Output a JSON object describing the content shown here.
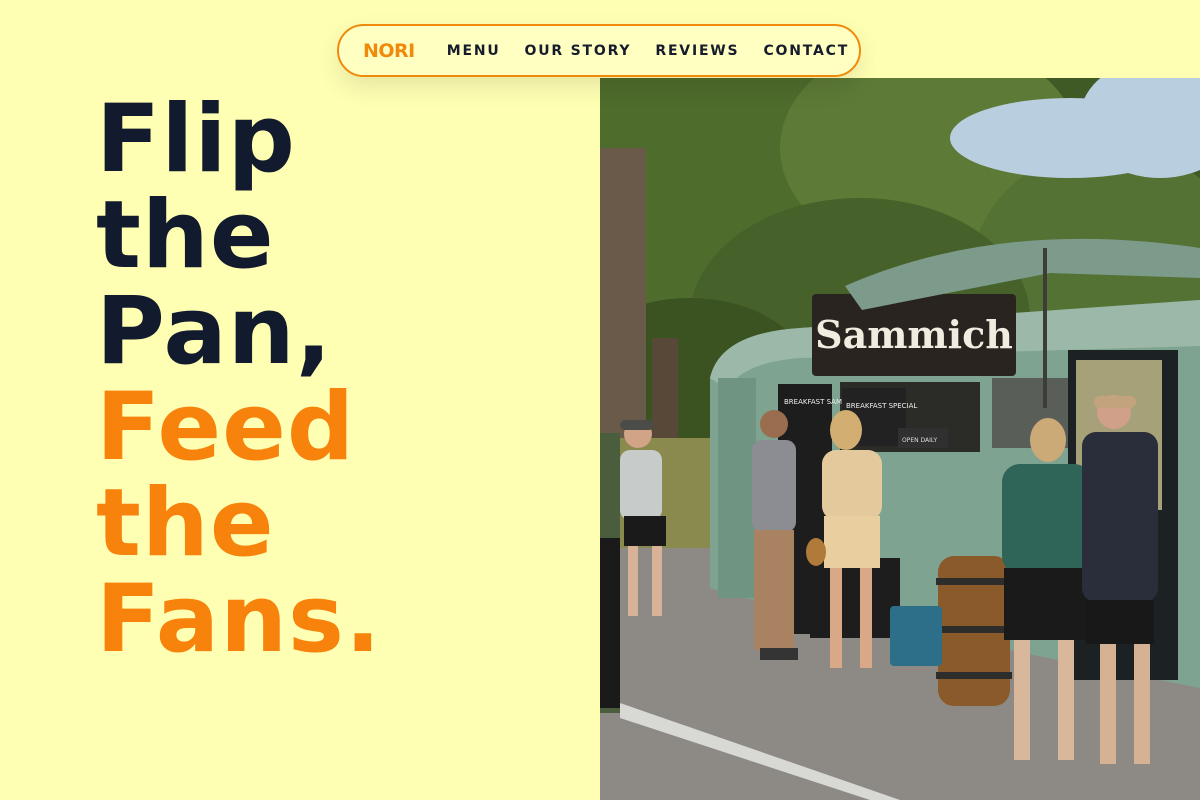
{
  "nav": {
    "brand": "NORI",
    "links": [
      "MENU",
      "OUR STORY",
      "REVIEWS",
      "CONTACT"
    ]
  },
  "hero": {
    "title_lines": [
      "Flip",
      "the",
      "Pan,"
    ],
    "title_accent_lines": [
      "Feed",
      "the",
      "Fans."
    ]
  },
  "photo": {
    "truck_sign": "Sammich",
    "board_left": "BREAKFAST SAMMICHES",
    "board_right": "BREAKFAST SPECIAL",
    "board_open": "OPEN DAILY"
  },
  "colors": {
    "background": "#ffffb3",
    "accent": "#f7820c",
    "text_dark": "#121a2e",
    "truck": "#7ea391"
  }
}
